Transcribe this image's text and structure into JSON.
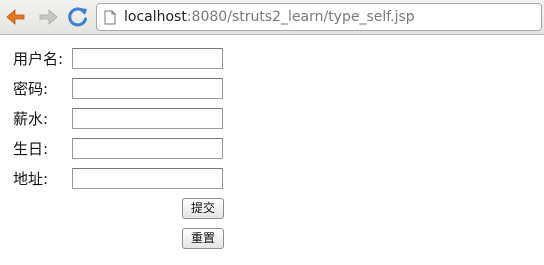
{
  "browser": {
    "url_host": "localhost",
    "url_rest": ":8080/struts2_learn/type_self.jsp",
    "back_icon_color": "#e8761e",
    "forward_icon_color": "#c8c8c8",
    "reload_icon_color": "#3d7fd6"
  },
  "form": {
    "username_label": "用户名:",
    "password_label": "密码:",
    "salary_label": "薪水:",
    "birthday_label": "生日:",
    "address_label": "地址:",
    "username_value": "",
    "password_value": "",
    "salary_value": "",
    "birthday_value": "",
    "address_value": "",
    "submit_label": "提交",
    "reset_label": "重置"
  }
}
